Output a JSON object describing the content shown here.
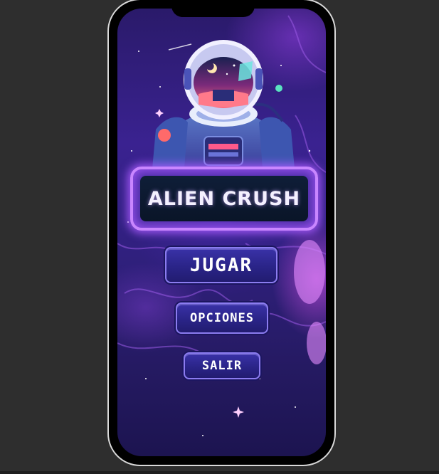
{
  "game": {
    "title": "ALIEN CRUSH"
  },
  "menu": {
    "play_label": "JUGAR",
    "options_label": "OPCIONES",
    "exit_label": "SALIR"
  },
  "colors": {
    "background": "#2e2e2e",
    "title_glow": "#c986ff",
    "button_fill": "#2a2488",
    "button_border": "#8b7cf0"
  }
}
